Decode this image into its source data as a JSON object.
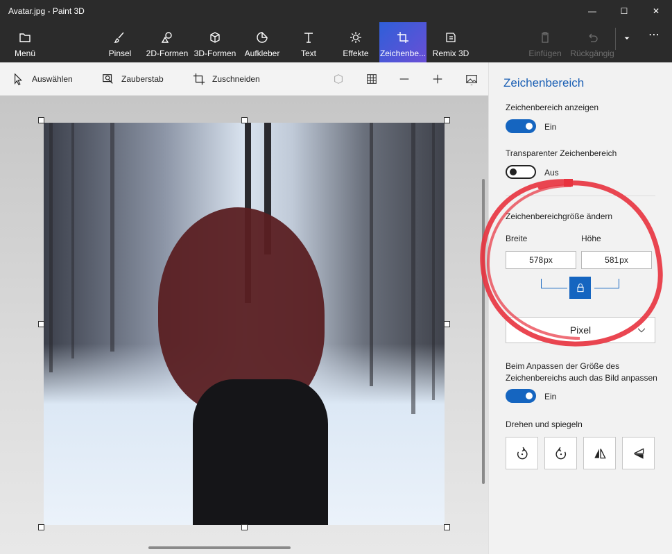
{
  "window": {
    "title": "Avatar.jpg - Paint 3D",
    "minimize": "—",
    "maximize": "☐",
    "close": "✕"
  },
  "ribbon": {
    "menu": "Menü",
    "brushes": "Pinsel",
    "shapes2d": "2D-Formen",
    "shapes3d": "3D-Formen",
    "stickers": "Aufkleber",
    "text": "Text",
    "effects": "Effekte",
    "canvas": "Zeichenbe...",
    "remix": "Remix 3D",
    "paste": "Einfügen",
    "undo": "Rückgängig",
    "more": "⋯"
  },
  "subbar": {
    "select": "Auswählen",
    "magic_select": "Zauberstab",
    "crop": "Zuschneiden"
  },
  "panel": {
    "title": "Zeichenbereich",
    "show_canvas_label": "Zeichenbereich anzeigen",
    "show_canvas_state": "Ein",
    "transparent_label": "Transparenter Zeichenbereich",
    "transparent_state": "Aus",
    "resize_label": "Zeichenbereichgröße ändern",
    "width_label": "Breite",
    "height_label": "Höhe",
    "width_value": "578",
    "height_value": "581",
    "unit_suffix": "px",
    "unit_select": "Pixel",
    "resize_image_note": "Beim Anpassen der Größe des Zeichenbereichs auch das Bild anpassen",
    "resize_image_state": "Ein",
    "rotate_label": "Drehen und spiegeln"
  },
  "colors": {
    "accent": "#1565c0",
    "active_tab_start": "#2f5fd8",
    "active_tab_end": "#6a4fd6",
    "annotation": "#e8323e"
  }
}
